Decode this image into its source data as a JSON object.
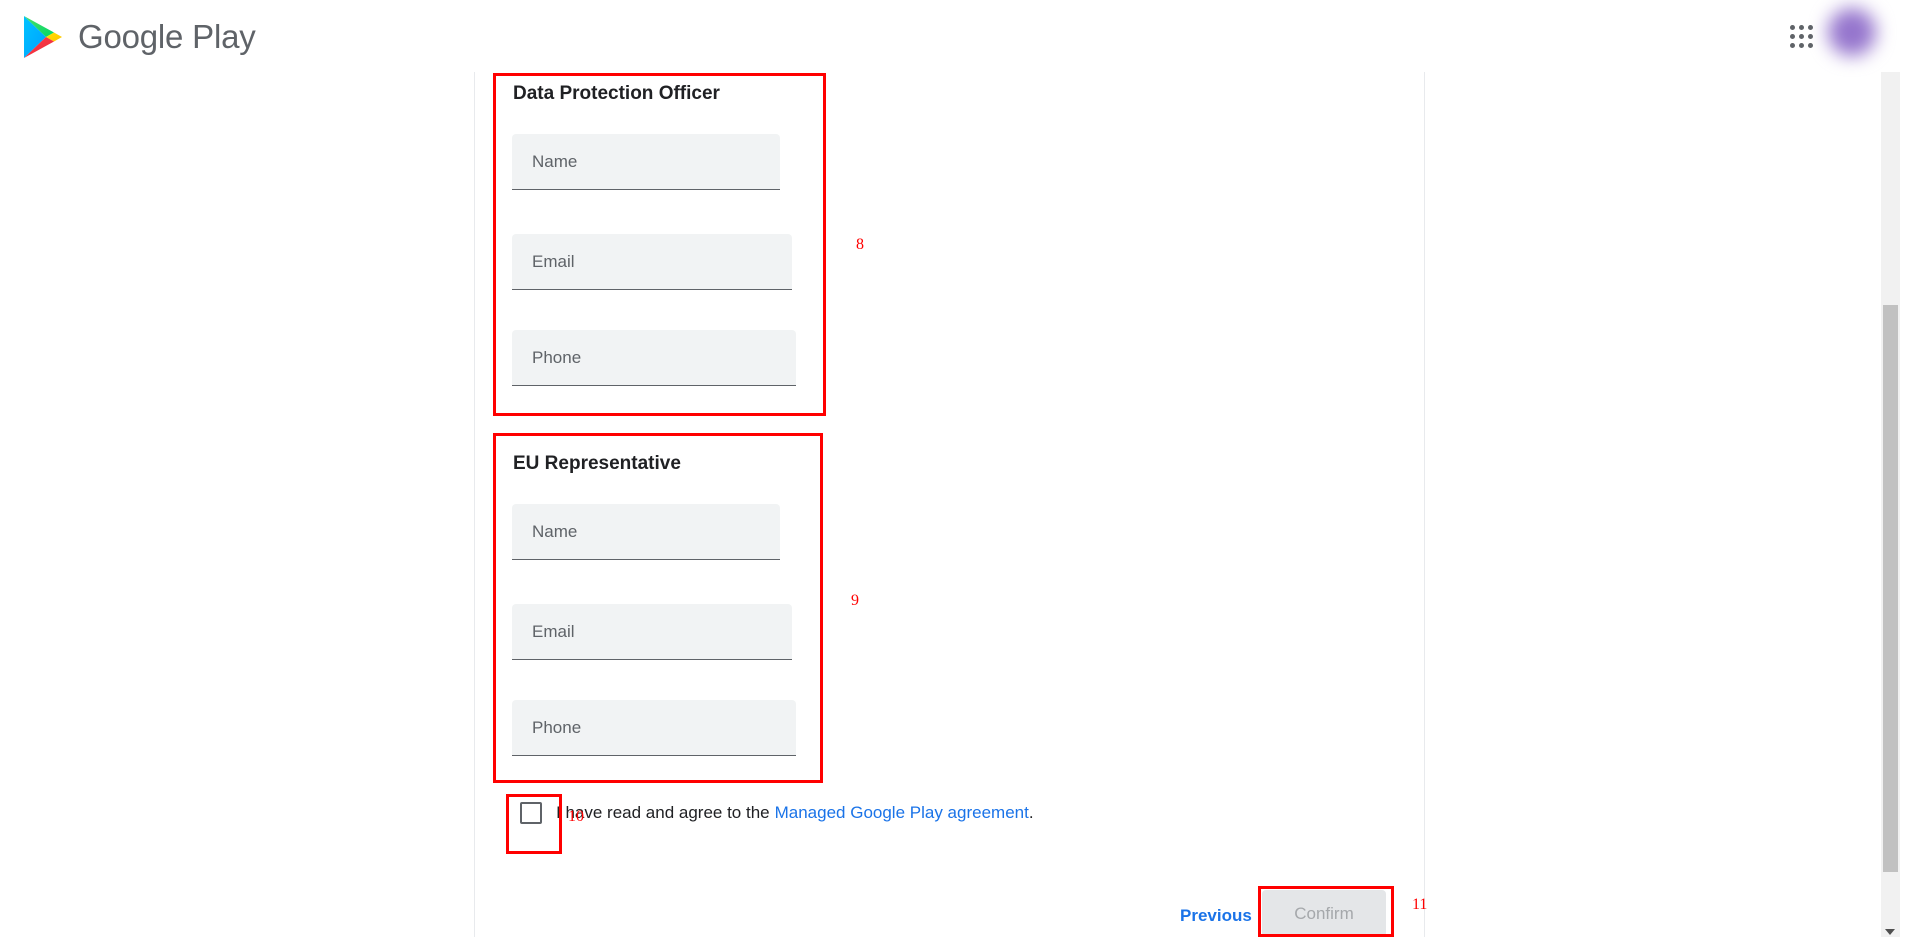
{
  "header": {
    "brand_name": "Google Play",
    "apps_icon": "apps-grid-icon",
    "avatar_icon": "user-avatar",
    "logo_icon": "google-play-triangle-icon"
  },
  "sections": [
    {
      "id": "dpo",
      "title": "Data Protection Officer",
      "annotation": "8",
      "fields": [
        {
          "name": "dpo-name",
          "placeholder": "Name",
          "value": ""
        },
        {
          "name": "dpo-email",
          "placeholder": "Email",
          "value": ""
        },
        {
          "name": "dpo-phone",
          "placeholder": "Phone",
          "value": ""
        }
      ]
    },
    {
      "id": "eurep",
      "title": "EU Representative",
      "annotation": "9",
      "fields": [
        {
          "name": "eurep-name",
          "placeholder": "Name",
          "value": ""
        },
        {
          "name": "eurep-email",
          "placeholder": "Email",
          "value": ""
        },
        {
          "name": "eurep-phone",
          "placeholder": "Phone",
          "value": ""
        }
      ]
    }
  ],
  "agreement": {
    "checked": false,
    "annotation": "10",
    "text": "I have read and agree to the",
    "link_text": "Managed Google Play agreement",
    "trailing": "."
  },
  "actions": {
    "previous_label": "Previous",
    "confirm_label": "Confirm",
    "confirm_disabled": true,
    "confirm_annotation": "11"
  },
  "colors": {
    "link": "#1a73e8",
    "annotation": "#ff0000",
    "field_bg": "#f1f3f4",
    "text": "#202124",
    "muted": "#5f6368"
  }
}
